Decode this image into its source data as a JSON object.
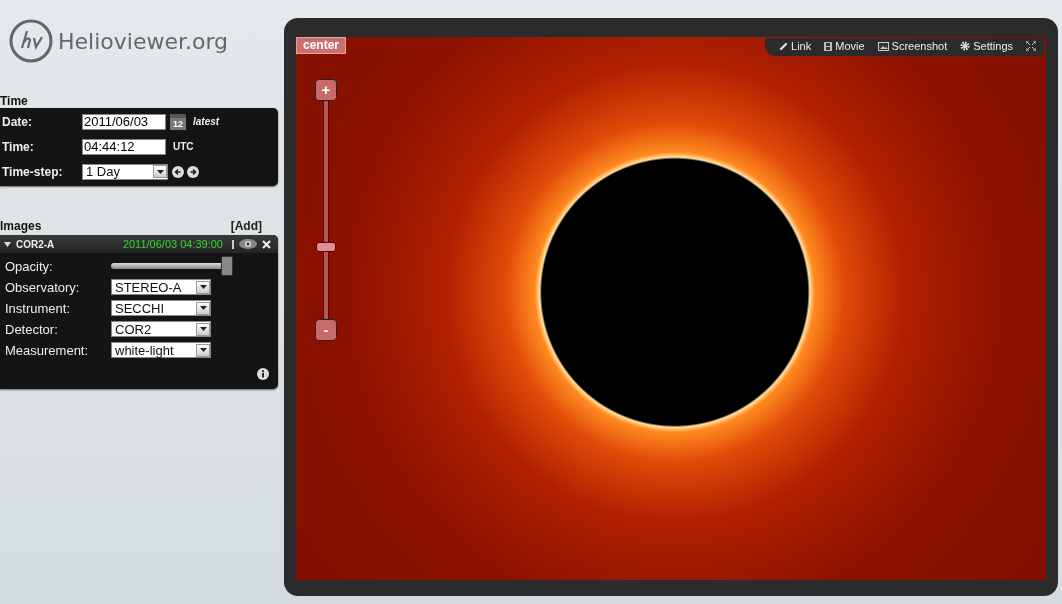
{
  "logo": {
    "text": "Helioviewer.org"
  },
  "time": {
    "heading": "Time",
    "date_label": "Date:",
    "date": "2011/06/03",
    "calendar_day": "12",
    "latest": "latest",
    "time_label": "Time:",
    "time": "04:44:12",
    "utc": "UTC",
    "step_label": "Time-step:",
    "step": "1 Day"
  },
  "images": {
    "heading": "Images",
    "add": "[Add]",
    "layers": [
      {
        "name": "COR2-A",
        "timestamp": "2011/06/03 04:39:00",
        "expanded": true,
        "visible": true,
        "opacity_label": "Opacity:",
        "opacity": {
          "level": 1
        },
        "fields": [
          {
            "label": "Observatory:",
            "value": "STEREO-A"
          },
          {
            "label": "Instrument:",
            "value": "SECCHI"
          },
          {
            "label": "Detector:",
            "value": "COR2"
          },
          {
            "label": "Measurement:",
            "value": "white-light"
          }
        ]
      }
    ]
  },
  "viewer": {
    "center": "center",
    "toolbar": [
      {
        "kind": "link",
        "label": "Link"
      },
      {
        "kind": "movie",
        "label": "Movie"
      },
      {
        "kind": "screenshot",
        "label": "Screenshot"
      },
      {
        "kind": "settings",
        "label": "Settings"
      }
    ],
    "zoom": {
      "plus": "+",
      "minus": "-",
      "level": 0.32
    }
  }
}
